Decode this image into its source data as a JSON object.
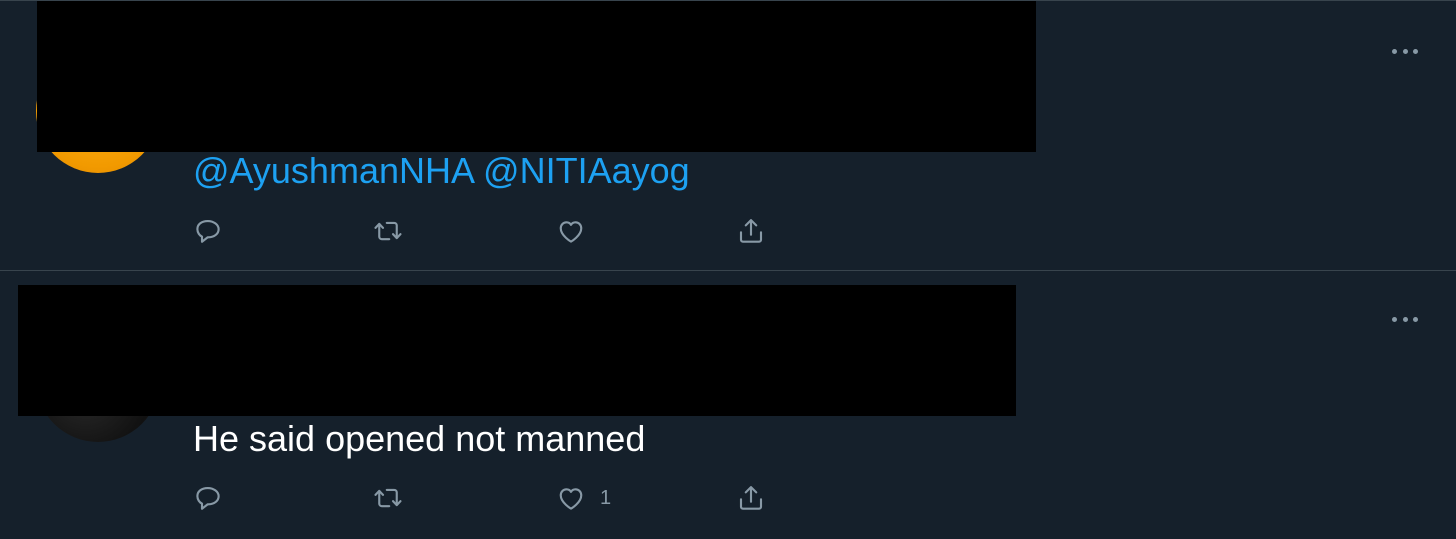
{
  "tweets": [
    {
      "text": "@AyushmanNHA @NITIAayog",
      "mentions": [
        "@AyushmanNHA",
        "@NITIAayog"
      ],
      "like_count": "",
      "avatar_color": "#f29a00"
    },
    {
      "text": "He said opened not manned",
      "like_count": "1",
      "avatar_color": "#111111"
    }
  ],
  "icons": {
    "reply": "reply-icon",
    "retweet": "retweet-icon",
    "like": "heart-icon",
    "share": "share-icon",
    "more": "more-options-icon"
  },
  "colors": {
    "background": "#15202b",
    "divider": "#38444d",
    "accent": "#1da1f2",
    "icon": "#8899a6",
    "text": "#ffffff",
    "redaction": "#000000"
  }
}
